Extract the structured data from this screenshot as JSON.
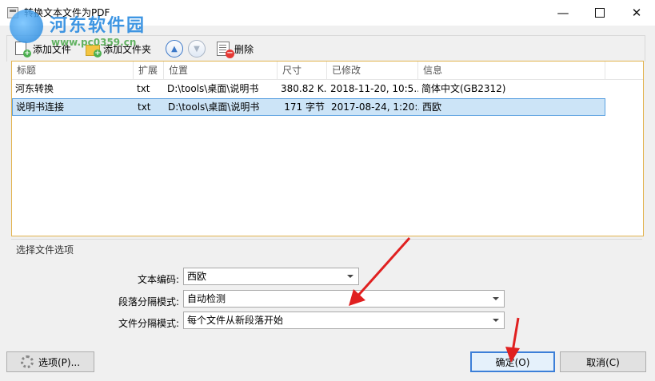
{
  "window": {
    "title": "转换文本文件为PDF"
  },
  "watermark": {
    "text": "河东软件园",
    "url": "www.pc0359.cn"
  },
  "toolbar": {
    "add_file": "添加文件",
    "add_folder": "添加文件夹",
    "delete": "删除"
  },
  "columns": [
    "标题",
    "扩展",
    "位置",
    "尺寸",
    "已修改",
    "信息"
  ],
  "rows": [
    {
      "title": "河东转换",
      "ext": "txt",
      "location": "D:\\tools\\桌面\\说明书",
      "size": "380.82 K..",
      "modified": "2018-11-20, 10:5..",
      "info": "简体中文(GB2312)"
    },
    {
      "title": "说明书连接",
      "ext": "txt",
      "location": "D:\\tools\\桌面\\说明书",
      "size": "171 字节",
      "modified": "2017-08-24, 1:20:..",
      "info": "西欧"
    }
  ],
  "options": {
    "section_title": "选择文件选项",
    "encoding_label": "文本编码:",
    "encoding_value": "西欧",
    "paragraph_label": "段落分隔模式:",
    "paragraph_value": "自动检测",
    "file_sep_label": "文件分隔模式:",
    "file_sep_value": "每个文件从新段落开始"
  },
  "buttons": {
    "options": "选项(P)...",
    "ok": "确定(O)",
    "cancel": "取消(C)"
  },
  "colors": {
    "selection": "#cce4f7",
    "annotation_arrow": "#e02020",
    "list_border": "#e2b34d"
  }
}
